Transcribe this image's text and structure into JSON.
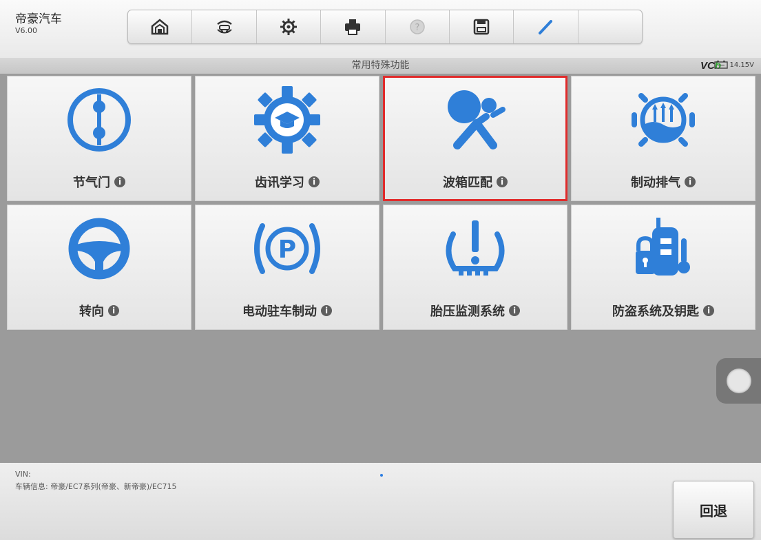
{
  "app": {
    "brand": "帝豪汽车",
    "version": "V6.00"
  },
  "toolbar": {
    "items": [
      {
        "icon": "home-icon"
      },
      {
        "icon": "vehicle-swap-icon"
      },
      {
        "icon": "settings-gear-icon"
      },
      {
        "icon": "print-icon"
      },
      {
        "icon": "help-icon"
      },
      {
        "icon": "save-icon"
      },
      {
        "icon": "pen-icon"
      }
    ]
  },
  "header": {
    "title": "常用特殊功能",
    "vci_text": "VC",
    "vci_accent": "b",
    "battery_voltage": "14.15V"
  },
  "functions": [
    {
      "label": "节气门",
      "icon": "throttle-icon",
      "selected": false
    },
    {
      "label": "齿讯学习",
      "icon": "gear-learning-icon",
      "selected": false
    },
    {
      "label": "波箱匹配",
      "icon": "airbag-icon",
      "selected": true
    },
    {
      "label": "制动排气",
      "icon": "brake-bleed-icon",
      "selected": false
    },
    {
      "label": "转向",
      "icon": "steering-wheel-icon",
      "selected": false
    },
    {
      "label": "电动驻车制动",
      "icon": "parking-brake-icon",
      "selected": false
    },
    {
      "label": "胎压监测系统",
      "icon": "tire-pressure-icon",
      "selected": false
    },
    {
      "label": "防盗系统及钥匙",
      "icon": "immobilizer-key-icon",
      "selected": false
    }
  ],
  "info_glyph": "i",
  "footer": {
    "vin_label": "VIN:",
    "vehicle_info": "车辆信息: 帝豪/EC7系列(帝豪、新帝豪)/EC715",
    "back_label": "回退"
  },
  "colors": {
    "icon_blue": "#2f7fd8",
    "selected_border": "#e12b2b",
    "vci_green": "#2fa32f"
  }
}
